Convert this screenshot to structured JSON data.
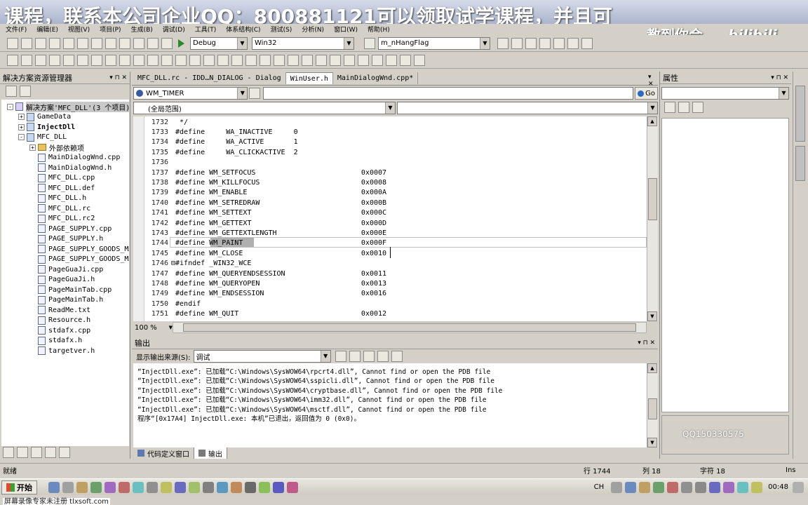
{
  "banner": {
    "text": "课程，联系本公司企业QQ：800881121可以领取试学课程，并且可",
    "sub": "教到你会",
    "brand": "bilibili"
  },
  "menubar": [
    "文件(F)",
    "编辑(E)",
    "视图(V)",
    "项目(P)",
    "生成(B)",
    "调试(D)",
    "工具(T)",
    "体系结构(C)",
    "测试(S)",
    "分析(N)",
    "窗口(W)",
    "帮助(H)"
  ],
  "toolbar": {
    "config": "Debug",
    "platform": "Win32",
    "find_value": "m_nHangFlag"
  },
  "solution_explorer": {
    "title": "解决方案资源管理器",
    "items": [
      {
        "label": "解决方案'MFC_DLL'(3 个项目)",
        "level": 0,
        "type": "solution",
        "pm": "-"
      },
      {
        "label": "GameData",
        "level": 1,
        "type": "project",
        "pm": "+"
      },
      {
        "label": "InjectDll",
        "level": 1,
        "type": "project",
        "pm": "+",
        "bold": true
      },
      {
        "label": "MFC_DLL",
        "level": 1,
        "type": "project",
        "pm": "-"
      },
      {
        "label": "外部依赖项",
        "level": 2,
        "type": "folder",
        "pm": "+"
      },
      {
        "label": "MainDialogWnd.cpp",
        "level": 2,
        "type": "file"
      },
      {
        "label": "MainDialogWnd.h",
        "level": 2,
        "type": "file"
      },
      {
        "label": "MFC_DLL.cpp",
        "level": 2,
        "type": "file"
      },
      {
        "label": "MFC_DLL.def",
        "level": 2,
        "type": "file"
      },
      {
        "label": "MFC_DLL.h",
        "level": 2,
        "type": "file"
      },
      {
        "label": "MFC_DLL.rc",
        "level": 2,
        "type": "file"
      },
      {
        "label": "MFC_DLL.rc2",
        "level": 2,
        "type": "file"
      },
      {
        "label": "PAGE_SUPPLY.cpp",
        "level": 2,
        "type": "file"
      },
      {
        "label": "PAGE_SUPPLY.h",
        "level": 2,
        "type": "file"
      },
      {
        "label": "PAGE_SUPPLY_GOODS_MAN",
        "level": 2,
        "type": "file"
      },
      {
        "label": "PAGE_SUPPLY_GOODS_MAN",
        "level": 2,
        "type": "file"
      },
      {
        "label": "PageGuaJi.cpp",
        "level": 2,
        "type": "file"
      },
      {
        "label": "PageGuaJi.h",
        "level": 2,
        "type": "file"
      },
      {
        "label": "PageMainTab.cpp",
        "level": 2,
        "type": "file"
      },
      {
        "label": "PageMainTab.h",
        "level": 2,
        "type": "file"
      },
      {
        "label": "ReadMe.txt",
        "level": 2,
        "type": "file"
      },
      {
        "label": "Resource.h",
        "level": 2,
        "type": "file"
      },
      {
        "label": "stdafx.cpp",
        "level": 2,
        "type": "file"
      },
      {
        "label": "stdafx.h",
        "level": 2,
        "type": "file"
      },
      {
        "label": "targetver.h",
        "level": 2,
        "type": "file"
      }
    ]
  },
  "editor": {
    "tabs": [
      {
        "label": "MFC_DLL.rc - IDD…N_DIALOG - Dialog",
        "active": false
      },
      {
        "label": "WinUser.h",
        "active": true
      },
      {
        "label": "MainDialogWnd.cpp*",
        "active": false
      }
    ],
    "member_combo": "WM_TIMER",
    "go_label": "Go",
    "scope": "(全局范围)",
    "zoom": "100 %",
    "lines": [
      {
        "n": "1732",
        "code": "  */"
      },
      {
        "n": "1733",
        "code": " #define     WA_INACTIVE     0"
      },
      {
        "n": "1734",
        "code": " #define     WA_ACTIVE       1"
      },
      {
        "n": "1735",
        "code": " #define     WA_CLICKACTIVE  2"
      },
      {
        "n": "1736",
        "code": ""
      },
      {
        "n": "1737",
        "code": " #define WM_SETFOCUS                         0x0007"
      },
      {
        "n": "1738",
        "code": " #define WM_KILLFOCUS                        0x0008"
      },
      {
        "n": "1739",
        "code": " #define WM_ENABLE                           0x000A"
      },
      {
        "n": "1740",
        "code": " #define WM_SETREDRAW                        0x000B"
      },
      {
        "n": "1741",
        "code": " #define WM_SETTEXT                          0x000C"
      },
      {
        "n": "1742",
        "code": " #define WM_GETTEXT                          0x000D"
      },
      {
        "n": "1743",
        "code": " #define WM_GETTEXTLENGTH                    0x000E"
      },
      {
        "n": "1744",
        "code": " #define WM_PAINT                            0x000F"
      },
      {
        "n": "1745",
        "code": " #define WM_CLOSE                            0x0010"
      },
      {
        "n": "1746",
        "code": "⊟#ifndef _WIN32_WCE"
      },
      {
        "n": "1747",
        "code": " #define WM_QUERYENDSESSION                  0x0011"
      },
      {
        "n": "1748",
        "code": " #define WM_QUERYOPEN                        0x0013"
      },
      {
        "n": "1749",
        "code": " #define WM_ENDSESSION                       0x0016"
      },
      {
        "n": "1750",
        "code": " #endif"
      },
      {
        "n": "1751",
        "code": " #define WM_QUIT                             0x0012"
      }
    ],
    "selected_word": "WM_PAINT"
  },
  "properties": {
    "title": "属性"
  },
  "output": {
    "title": "输出",
    "source_label": "显示输出来源(S):",
    "source_value": "调试",
    "lines": [
      "“InjectDll.exe”: 已加载“C:\\Windows\\SysWOW64\\rpcrt4.dll”, Cannot find or open the PDB file",
      "“InjectDll.exe”: 已加载“C:\\Windows\\SysWOW64\\sspicli.dll”, Cannot find or open the PDB file",
      "“InjectDll.exe”: 已加载“C:\\Windows\\SysWOW64\\cryptbase.dll”, Cannot find or open the PDB file",
      "“InjectDll.exe”: 已加载“C:\\Windows\\SysWOW64\\imm32.dll”, Cannot find or open the PDB file",
      "“InjectDll.exe”: 已加载“C:\\Windows\\SysWOW64\\msctf.dll”, Cannot find or open the PDB file",
      "程序“[0x17A4] InjectDll.exe: 本机”已退出，返回值为 0 (0x0)。"
    ],
    "tabs": [
      "代码定义窗口",
      "输出"
    ]
  },
  "watermark_qq": "QQ150330575",
  "statusbar": {
    "ready": "就绪",
    "row": "行 1744",
    "col": "列 18",
    "ch": "字符 18",
    "ins": "Ins"
  },
  "taskbar": {
    "start": "开始",
    "lang": "CH",
    "clock": "00:48",
    "footer": "屏幕录像专家未注册  tlxsoft.com"
  }
}
